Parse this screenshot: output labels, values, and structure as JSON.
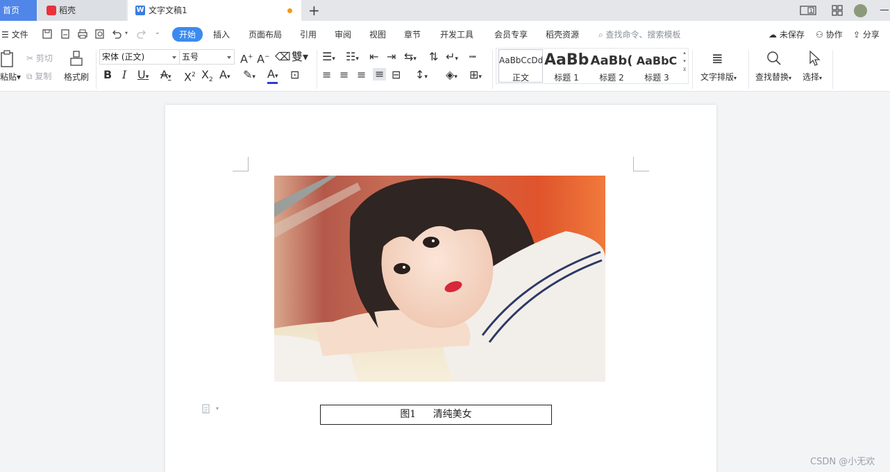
{
  "tabs": {
    "home": "首页",
    "daoke": "稻壳",
    "doc": "文字文稿1"
  },
  "menu": {
    "file": "文件",
    "items": [
      "开始",
      "插入",
      "页面布局",
      "引用",
      "审阅",
      "视图",
      "章节",
      "开发工具",
      "会员专享",
      "稻壳资源"
    ],
    "search_hint": "查找命令、搜索模板",
    "unsaved": "未保存",
    "collab": "协作",
    "share": "分享"
  },
  "ribbon": {
    "paste": "粘贴",
    "cut": "剪切",
    "copy": "复制",
    "format_painter": "格式刷",
    "font_name": "宋体 (正文)",
    "font_size": "五号",
    "styles": [
      {
        "sample": "AaBbCcDd",
        "name": "正文"
      },
      {
        "sample": "AaBb",
        "name": "标题 1"
      },
      {
        "sample": "AaBb(",
        "name": "标题 2"
      },
      {
        "sample": "AaBbC",
        "name": "标题 3"
      }
    ],
    "text_layout": "文字排版",
    "find_replace": "查找替换",
    "select": "选择"
  },
  "document": {
    "figure_label": "图1",
    "figure_title": "清纯美女"
  },
  "watermark": "CSDN @小无欢",
  "colors": {
    "accent": "#3b8af0",
    "home_tab": "#4f86e8"
  }
}
